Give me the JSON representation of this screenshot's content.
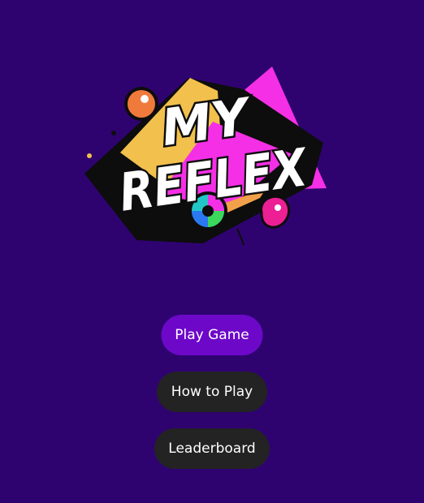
{
  "logo": {
    "line1": "MY",
    "line2": "REFLEX",
    "colors": {
      "magenta": "#f52fe6",
      "yellow": "#f2c04c",
      "orange": "#f07a3c",
      "black": "#0d0d0d",
      "white": "#ffffff",
      "pink": "#ec1f94"
    }
  },
  "menu": {
    "play_label": "Play Game",
    "how_to_label": "How to Play",
    "leaderboard_label": "Leaderboard"
  },
  "colors": {
    "background": "#2e0370",
    "primary_button": "#6d08c9",
    "secondary_button": "#232323",
    "button_text": "#ffffff"
  }
}
